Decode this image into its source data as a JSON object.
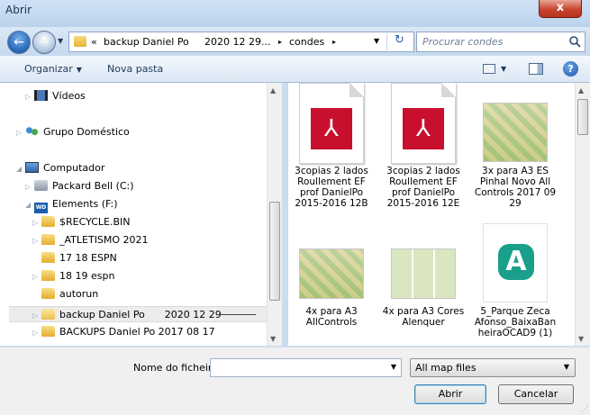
{
  "window": {
    "title": "Abrir",
    "close_label": "x"
  },
  "address": {
    "back_icon": "back-arrow-icon",
    "forward_icon": "forward-arrow-icon",
    "overflow": "«",
    "segments": [
      "backup Daniel Po",
      "2020 12 29",
      "...",
      "condes"
    ],
    "separator": "▸",
    "refresh_icon": "refresh-icon"
  },
  "search": {
    "placeholder": "Procurar condes"
  },
  "toolbar": {
    "organize": "Organizar",
    "new_folder": "Nova pasta"
  },
  "nav": {
    "videos": "Vídeos",
    "homegroup": "Grupo Doméstico",
    "computer": "Computador",
    "drive_c": "Packard Bell (C:)",
    "drive_f": "Elements (F:)",
    "drive_f_badge": "WD",
    "folders": [
      "$RECYCLE.BIN",
      "_ATLETISMO 2021",
      "17 18 ESPN",
      "18 19 espn",
      "autorun"
    ],
    "selected_folder": "backup Daniel Po",
    "selected_folder_date": "2020 12 29",
    "last_folder": "BACKUPS Daniel Po 2017 08 17"
  },
  "files": [
    {
      "line1": "3copias 2 lados",
      "line2": "Roullement EF",
      "line3": "prof DanielPo",
      "line4": "2015-2016 12B",
      "kind": "pdf"
    },
    {
      "line1": "3copias 2 lados",
      "line2": "Roullement EF",
      "line3": "prof DanielPo",
      "line4": "2015-2016 12E",
      "kind": "pdf"
    },
    {
      "line1": "3x para A3   ES",
      "line2": "Pinhal Novo All",
      "line3": "Controls 2017 09",
      "line4": "29",
      "kind": "map"
    },
    {
      "line1": "4x para A3",
      "line2": "AllControls",
      "kind": "map"
    },
    {
      "line1": "4x para A3 Cores",
      "line2": "Alenquer",
      "kind": "map"
    },
    {
      "line1": "5_Parque Zeca",
      "line2": "Afonso_BaixaBan",
      "line3": "heiraOCAD9 (1)",
      "kind": "ocad"
    }
  ],
  "pdf_glyph": "⅄",
  "ocad_glyph": "A",
  "bottom": {
    "filename_label": "Nome do ficheiro:",
    "filename_value": "",
    "filter": "All map files",
    "open": "Abrir",
    "cancel": "Cancelar"
  },
  "colors": {
    "accent": "#1c5fb0",
    "close": "#c9452f"
  }
}
